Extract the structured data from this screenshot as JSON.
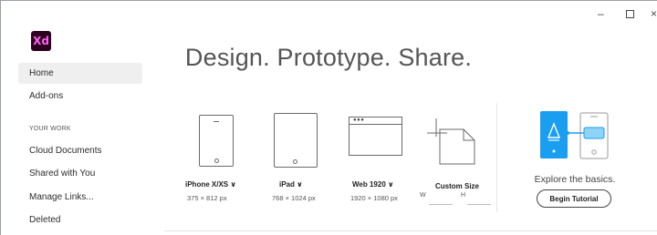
{
  "app": {
    "logo_text": "Xd",
    "brand_colors": {
      "logo_bg": "#2e001f",
      "logo_text": "#ff61f6",
      "accent": "#1a9ef0"
    }
  },
  "window_controls": {
    "minimize": "–",
    "maximize": "",
    "close": "×"
  },
  "sidebar": {
    "items": [
      {
        "label": "Home",
        "active": true
      },
      {
        "label": "Add-ons",
        "active": false
      }
    ],
    "section_title": "YOUR WORK",
    "work_items": [
      {
        "label": "Cloud Documents"
      },
      {
        "label": "Shared with You"
      },
      {
        "label": "Manage Links..."
      },
      {
        "label": "Deleted"
      }
    ]
  },
  "main": {
    "headline": "Design. Prototype. Share.",
    "presets": [
      {
        "label": "iPhone X/XS ∨",
        "size": "375 × 812 px",
        "icon": "phone-icon"
      },
      {
        "label": "iPad ∨",
        "size": "768 × 1024 px",
        "icon": "tablet-icon"
      },
      {
        "label": "Web 1920 ∨",
        "size": "1920 × 1080 px",
        "icon": "browser-window-icon"
      },
      {
        "label": "Custom Size",
        "icon": "custom-size-icon",
        "width_label": "W",
        "height_label": "H",
        "width_value": "",
        "height_value": ""
      }
    ],
    "tutorial": {
      "explore_text": "Explore the basics.",
      "button_label": "Begin Tutorial",
      "icon": "tutorial-prototype-icon"
    }
  }
}
